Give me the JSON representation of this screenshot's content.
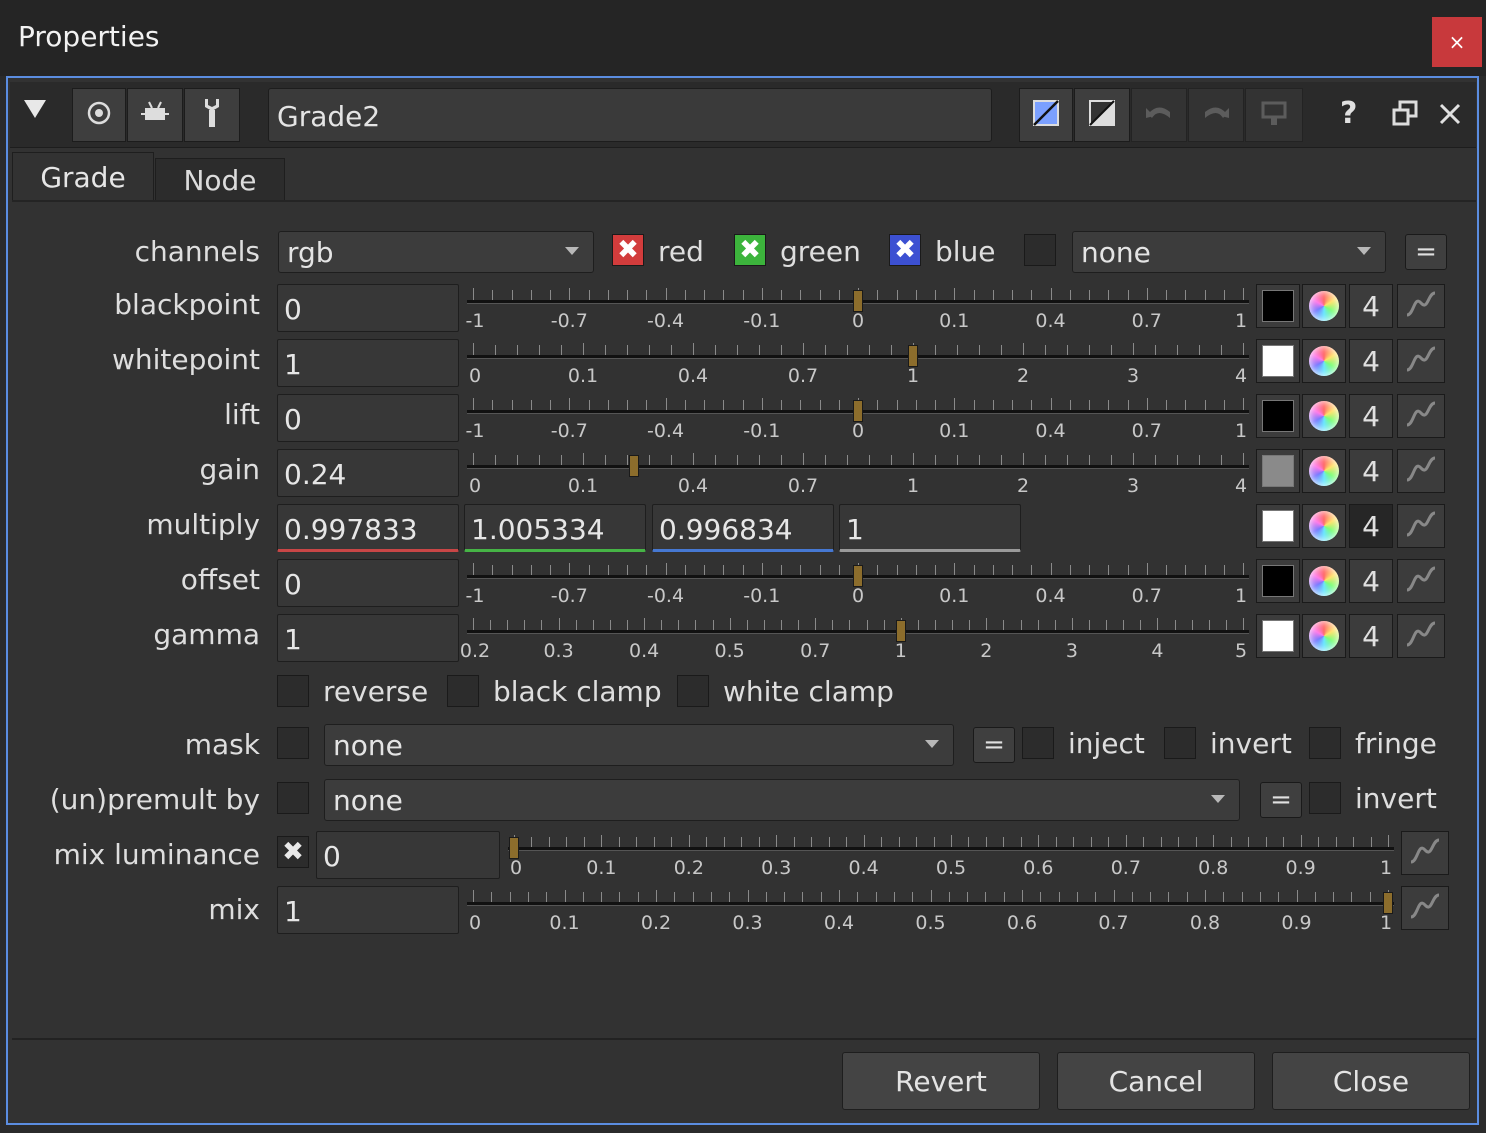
{
  "window": {
    "title": "Properties",
    "close_glyph": "×"
  },
  "header": {
    "node_name": "Grade2",
    "help_glyph": "?"
  },
  "tabs": [
    "Grade",
    "Node"
  ],
  "channels": {
    "label": "channels",
    "value": "rgb",
    "red": "red",
    "green": "green",
    "blue": "blue",
    "extra": "none",
    "eq": "="
  },
  "knobs": {
    "blackpoint": {
      "label": "blackpoint",
      "value": "0",
      "swatch": "#000000",
      "count": "4"
    },
    "whitepoint": {
      "label": "whitepoint",
      "value": "1",
      "swatch": "#ffffff",
      "count": "4"
    },
    "lift": {
      "label": "lift",
      "value": "0",
      "swatch": "#000000",
      "count": "4"
    },
    "gain": {
      "label": "gain",
      "value": "0.24",
      "swatch": "#8a8a8a",
      "count": "4"
    },
    "multiply": {
      "label": "multiply",
      "values": [
        "0.997833",
        "1.005334",
        "0.996834",
        "1"
      ],
      "swatch": "#ffffff",
      "count": "4"
    },
    "offset": {
      "label": "offset",
      "value": "0",
      "swatch": "#000000",
      "count": "4"
    },
    "gamma": {
      "label": "gamma",
      "value": "1",
      "swatch": "#ffffff",
      "count": "4"
    }
  },
  "scales": {
    "signed": [
      "-1",
      "-0.7",
      "-0.4",
      "-0.1",
      "0",
      "0.1",
      "0.4",
      "0.7",
      "1"
    ],
    "white": [
      "0",
      "0.1",
      "0.4",
      "0.7",
      "1",
      "2",
      "3",
      "4"
    ],
    "gamma": [
      "0.2",
      "0.3",
      "0.4",
      "0.5",
      "0.7",
      "1",
      "2",
      "3",
      "4",
      "5"
    ],
    "unit": [
      "0",
      "0.1",
      "0.2",
      "0.3",
      "0.4",
      "0.5",
      "0.6",
      "0.7",
      "0.8",
      "0.9",
      "1"
    ]
  },
  "options": {
    "reverse": "reverse",
    "black_clamp": "black clamp",
    "white_clamp": "white clamp"
  },
  "mask": {
    "label": "mask",
    "value": "none",
    "eq": "=",
    "inject": "inject",
    "invert": "invert",
    "fringe": "fringe"
  },
  "premult": {
    "label": "(un)premult by",
    "value": "none",
    "eq": "=",
    "invert": "invert"
  },
  "mix_luminance": {
    "label": "mix luminance",
    "value": "0",
    "enabled_glyph": "✖"
  },
  "mix": {
    "label": "mix",
    "value": "1"
  },
  "footer": {
    "revert": "Revert",
    "cancel": "Cancel",
    "close": "Close"
  },
  "colors": {
    "accent": "#5b8de0",
    "red_check": "#d23c3c",
    "green_check": "#3cb43c",
    "blue_check": "#3c50d2",
    "knob": "#8c6d2c"
  }
}
